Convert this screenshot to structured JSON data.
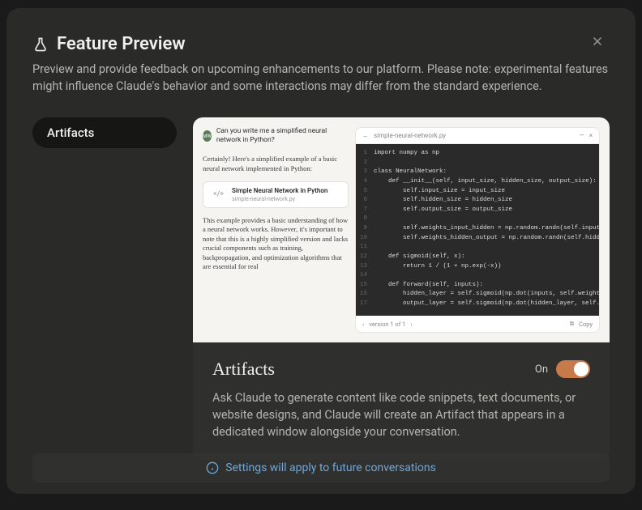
{
  "header": {
    "title": "Feature Preview",
    "description": "Preview and provide feedback on upcoming enhancements to our platform. Please note: experimental features might influence Claude's behavior and some interactions may differ from the standard experience."
  },
  "sidebar": {
    "items": [
      {
        "label": "Artifacts"
      }
    ]
  },
  "feature": {
    "title": "Artifacts",
    "toggle_label": "On",
    "toggle_state": "on",
    "description": "Ask Claude to generate content like code snippets, text documents, or website designs, and Claude will create an Artifact that appears in a dedicated window alongside your conversation."
  },
  "preview": {
    "avatar_initials": "MW",
    "prompt": "Can you write me a simplified neural network in Python?",
    "response1": "Certainly! Here's a simplified example of a basic neural network implemented in Python:",
    "artifact_card": {
      "title": "Simple Neural Network in Python",
      "filename": "simple-neural-network.py"
    },
    "response2": "This example provides a basic understanding of how a neural network works. However, it's important to note that this is a highly simplified version and lacks crucial components such as training, backpropagation, and optimization algorithms that are essential for real",
    "code_toolbar": {
      "filename": "simple-neural-network.py",
      "minimize": "—",
      "close": "×"
    },
    "code_footer": {
      "version": "version 1 of 1",
      "copy": "Copy"
    },
    "code_lines": [
      {
        "n": "1",
        "html": "<span class='kw'>import</span> numpy <span class='kw'>as</span> np"
      },
      {
        "n": "2",
        "html": ""
      },
      {
        "n": "3",
        "html": "<span class='kw'>class</span> <span class='cls'>NeuralNetwork</span>:"
      },
      {
        "n": "4",
        "html": "    <span class='kw'>def</span> <span class='fn'>__init__</span>(self, input_size, hidden_size, output_size):"
      },
      {
        "n": "5",
        "html": "        self.input_size = input_size"
      },
      {
        "n": "6",
        "html": "        self.hidden_size = hidden_size"
      },
      {
        "n": "7",
        "html": "        self.output_size = output_size"
      },
      {
        "n": "8",
        "html": ""
      },
      {
        "n": "9",
        "html": "        self.weights_input_hidden = np.random.randn(self.input_size"
      },
      {
        "n": "10",
        "html": "        self.weights_hidden_output = np.random.randn(self.hidden_si"
      },
      {
        "n": "11",
        "html": ""
      },
      {
        "n": "12",
        "html": "    <span class='kw'>def</span> <span class='fn'>sigmoid</span>(self, x):"
      },
      {
        "n": "13",
        "html": "        <span class='kw'>return</span> <span class='num'>1</span> / (<span class='num'>1</span> + np.exp(-x))"
      },
      {
        "n": "14",
        "html": ""
      },
      {
        "n": "15",
        "html": "    <span class='kw'>def</span> <span class='fn'>forward</span>(self, inputs):"
      },
      {
        "n": "16",
        "html": "        hidden_layer = self.sigmoid(np.dot(inputs, self.weights_in"
      },
      {
        "n": "17",
        "html": "        output_layer = self.sigmoid(np.dot(hidden_layer, self.weig"
      }
    ]
  },
  "footer": {
    "notice": "Settings will apply to future conversations"
  }
}
